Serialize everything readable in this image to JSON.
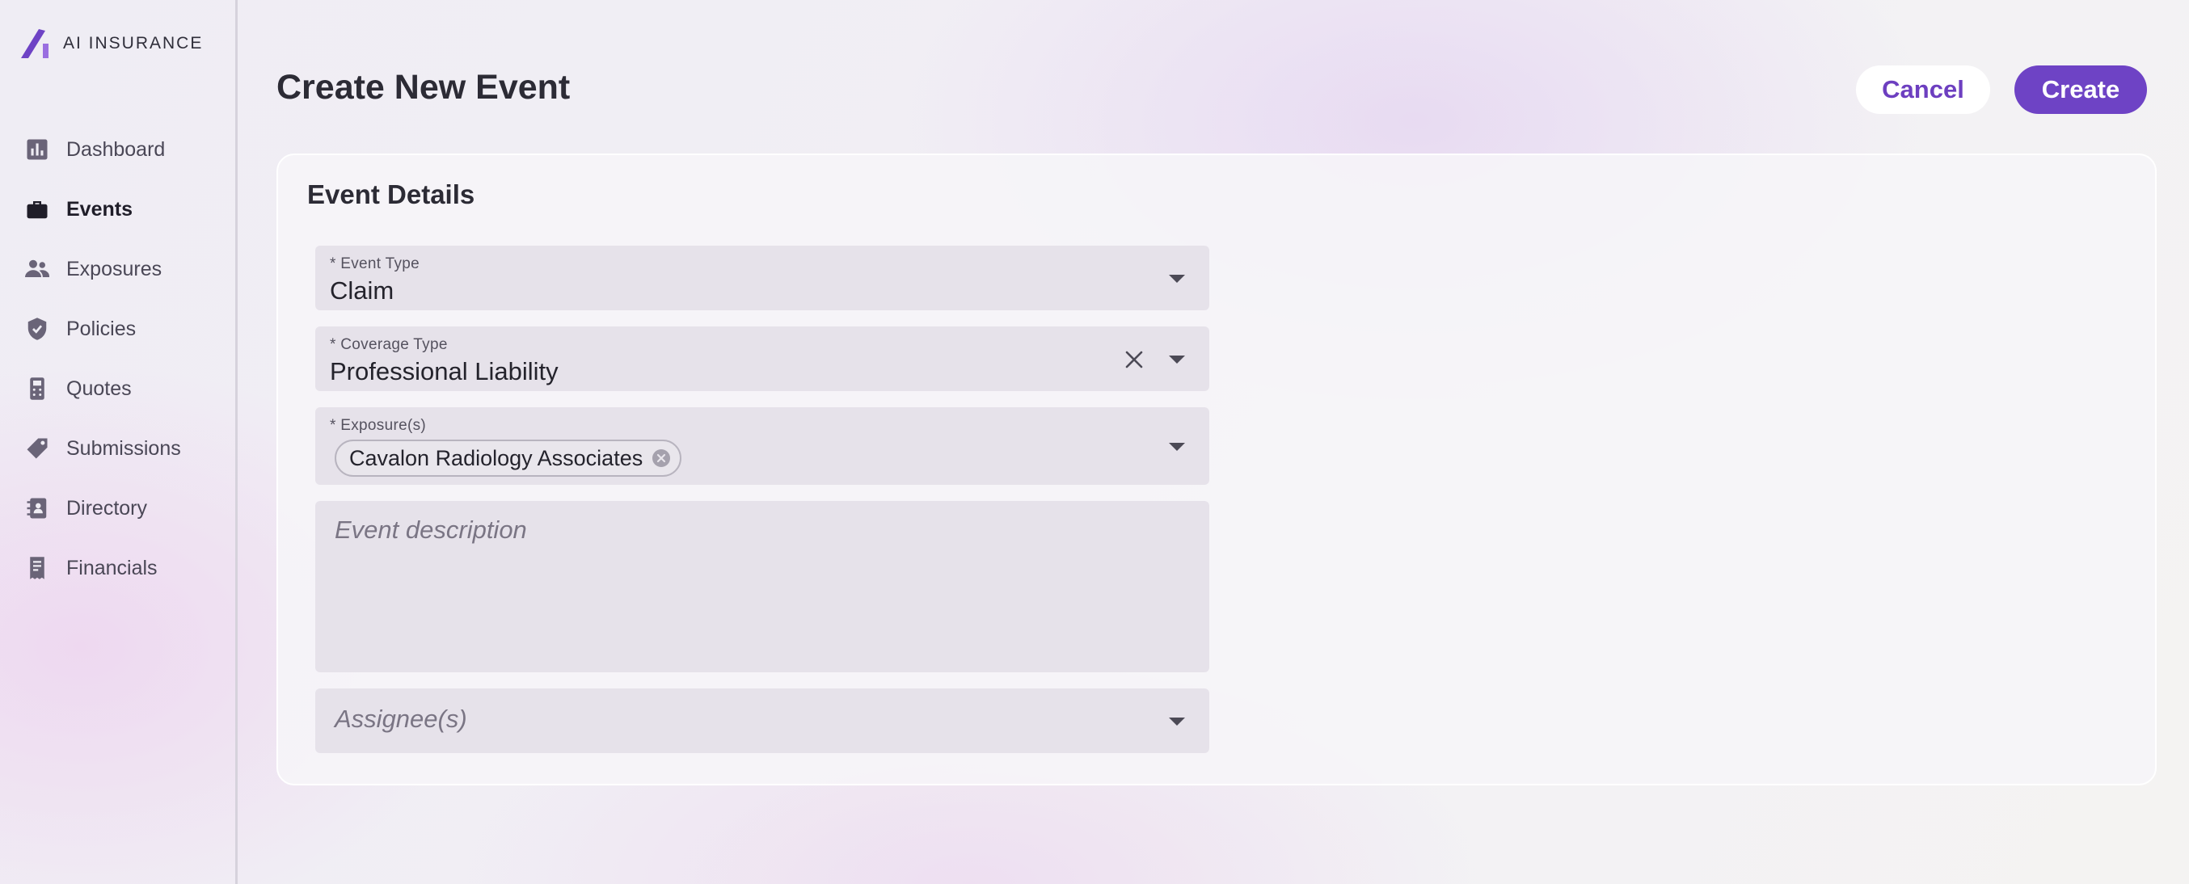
{
  "app": {
    "logo_text": "AI INSURANCE",
    "brand_color": "#6e43c5"
  },
  "sidebar": {
    "items": [
      {
        "label": "Dashboard",
        "icon": "bar-chart-icon",
        "active": false
      },
      {
        "label": "Events",
        "icon": "briefcase-icon",
        "active": true
      },
      {
        "label": "Exposures",
        "icon": "people-icon",
        "active": false
      },
      {
        "label": "Policies",
        "icon": "shield-check-icon",
        "active": false
      },
      {
        "label": "Quotes",
        "icon": "calculator-icon",
        "active": false
      },
      {
        "label": "Submissions",
        "icon": "tag-icon",
        "active": false
      },
      {
        "label": "Directory",
        "icon": "contact-book-icon",
        "active": false
      },
      {
        "label": "Financials",
        "icon": "receipt-icon",
        "active": false
      }
    ]
  },
  "header": {
    "title": "Create New Event",
    "cancel_label": "Cancel",
    "create_label": "Create"
  },
  "card": {
    "title": "Event Details",
    "event_type": {
      "label": "* Event Type",
      "value": "Claim"
    },
    "coverage_type": {
      "label": "* Coverage Type",
      "value": "Professional Liability"
    },
    "exposures": {
      "label": "* Exposure(s)",
      "chips": [
        "Cavalon Radiology Associates"
      ]
    },
    "description": {
      "placeholder": "Event description",
      "value": ""
    },
    "assignees": {
      "placeholder": "Assignee(s)"
    }
  }
}
